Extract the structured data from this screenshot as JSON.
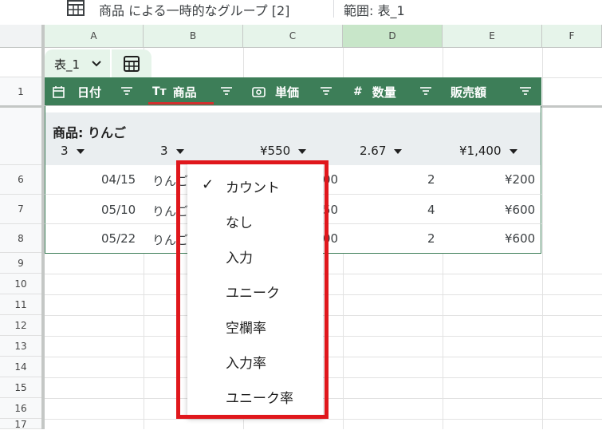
{
  "topbar": {
    "title": "商品 による一時的なグループ [2]",
    "range": "範囲:  表_1"
  },
  "columns": [
    "A",
    "B",
    "C",
    "D",
    "E",
    "F"
  ],
  "rows": [
    "1",
    "6",
    "7",
    "8",
    "9",
    "10",
    "11",
    "12",
    "13",
    "14",
    "15",
    "16",
    "17"
  ],
  "table": {
    "name": "表_1",
    "headers": [
      {
        "label": "日付",
        "icon": "calendar-icon"
      },
      {
        "label": "商品",
        "icon": "Tт"
      },
      {
        "label": "単価",
        "icon": "money-icon"
      },
      {
        "label": "数量",
        "icon": "#"
      },
      {
        "label": "販売額",
        "icon": ""
      }
    ],
    "group_title": "商品: りんご",
    "aggregates": [
      "3",
      "3",
      "¥550",
      "2.67",
      "¥1,400"
    ],
    "data": [
      {
        "date": "04/15",
        "product": "りんご",
        "price_tail": "00",
        "qty": "2",
        "amount": "¥200"
      },
      {
        "date": "05/10",
        "product": "りんご",
        "price_tail": "50",
        "qty": "4",
        "amount": "¥600"
      },
      {
        "date": "05/22",
        "product": "りんご",
        "price_tail": "00",
        "qty": "2",
        "amount": "¥600"
      }
    ]
  },
  "dropdown": {
    "items": [
      "カウント",
      "なし",
      "入力",
      "ユニーク",
      "空欄率",
      "入力率",
      "ユニーク率"
    ],
    "selected": "カウント",
    "check": "✓"
  },
  "colors": {
    "table_header": "#3d7e58",
    "highlight_box": "#e0171c",
    "column_header_bg": "#e6f4ea"
  }
}
